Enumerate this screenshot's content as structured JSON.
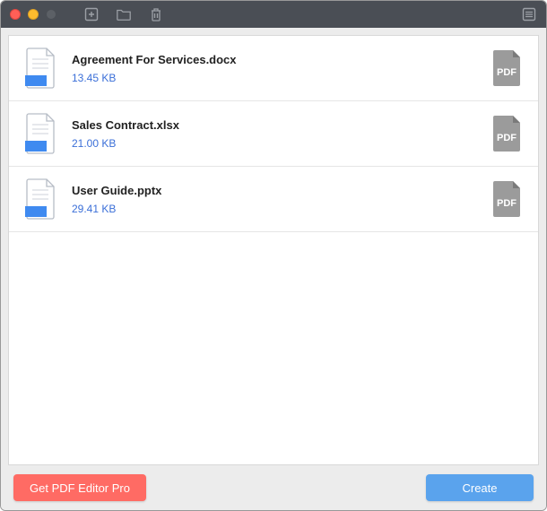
{
  "files": [
    {
      "name": "Agreement For Services.docx",
      "size": "13.45 KB"
    },
    {
      "name": "Sales Contract.xlsx",
      "size": "21.00 KB"
    },
    {
      "name": "User Guide.pptx",
      "size": "29.41 KB"
    }
  ],
  "pdf_badge": "PDF",
  "footer": {
    "pro_label": "Get PDF Editor Pro",
    "create_label": "Create"
  }
}
